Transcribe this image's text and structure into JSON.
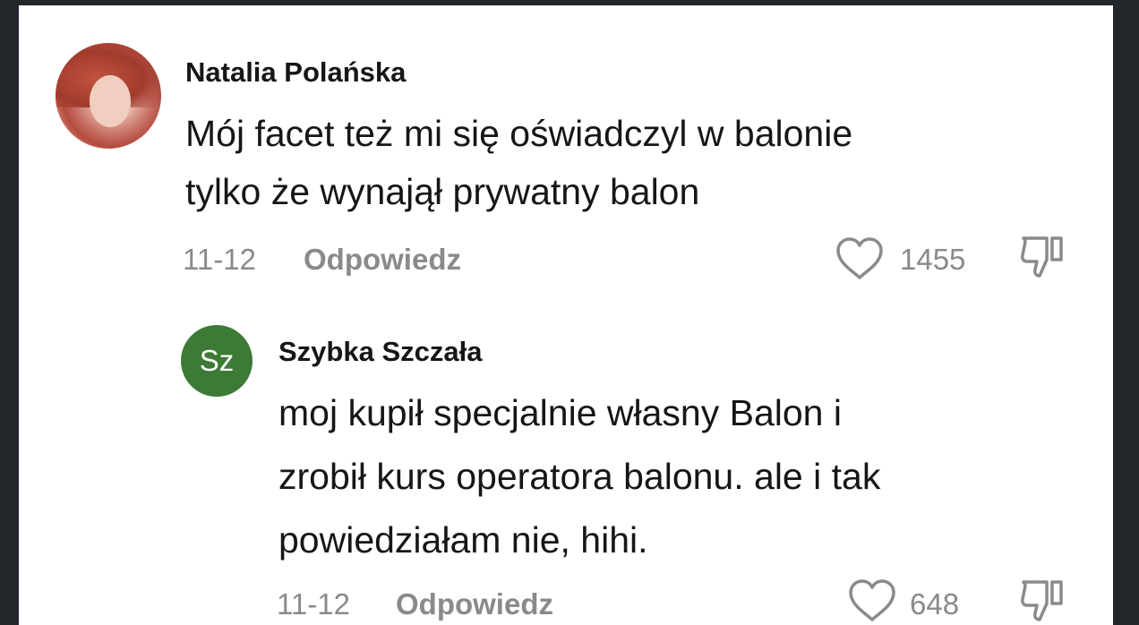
{
  "comments": [
    {
      "author": "Natalia Polańska",
      "text_lines": [
        "Mój facet też mi się oświadczyl w balonie",
        "tylko że wynajął prywatny balon"
      ],
      "date": "11-12",
      "reply_label": "Odpowiedz",
      "likes": "1455",
      "avatar": "profile-photo"
    },
    {
      "author": "Szybka Szczała",
      "avatar_initials": "Sz",
      "avatar_color": "#3c7a36",
      "text_lines": [
        "moj kupił specjalnie własny Balon i",
        "zrobił kurs operatora balonu. ale i tak",
        "powiedziałam nie, hihi."
      ],
      "date": "11-12",
      "reply_label": "Odpowiedz",
      "likes": "648"
    }
  ],
  "icons": {
    "like": "heart-outline-icon",
    "dislike": "thumbs-down-outline-icon"
  },
  "colors": {
    "frame": "#23262b",
    "background": "#ffffff",
    "text": "#161616",
    "meta": "#8a8a8a"
  }
}
